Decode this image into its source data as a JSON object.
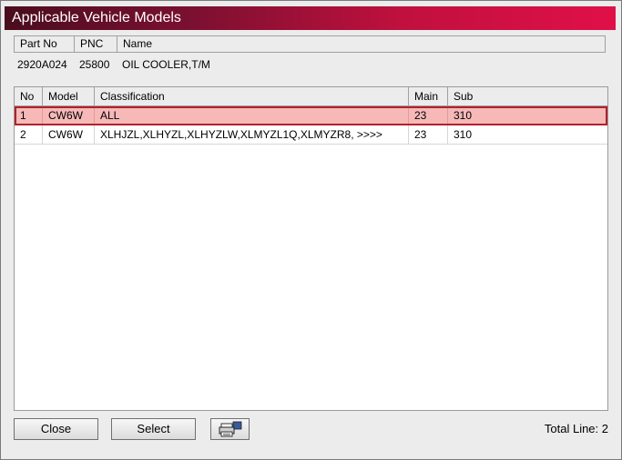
{
  "window": {
    "title": "Applicable Vehicle Models"
  },
  "part": {
    "headers": {
      "part_no": "Part No",
      "pnc": "PNC",
      "name": "Name"
    },
    "values": {
      "part_no": "2920A024",
      "pnc": "25800",
      "name": "OIL COOLER,T/M"
    }
  },
  "grid": {
    "columns": {
      "no": "No",
      "model": "Model",
      "classification": "Classification",
      "main": "Main",
      "sub": "Sub"
    },
    "rows": [
      {
        "no": "1",
        "model": "CW6W",
        "classification": "ALL",
        "main": "23",
        "sub": "310",
        "selected": true
      },
      {
        "no": "2",
        "model": "CW6W",
        "classification": "XLHJZL,XLHYZL,XLHYZLW,XLMYZL1Q,XLMYZR8,  >>>>",
        "main": "23",
        "sub": "310",
        "selected": false
      }
    ]
  },
  "footer": {
    "close_label": "Close",
    "select_label": "Select",
    "print_icon": "printer-icon",
    "total_label": "Total Line: 2"
  },
  "colors": {
    "title_gradient_start": "#4a0d1d",
    "title_gradient_end": "#e01048",
    "selected_row_bg": "#f7b8b8",
    "selected_row_border": "#b0212b"
  }
}
